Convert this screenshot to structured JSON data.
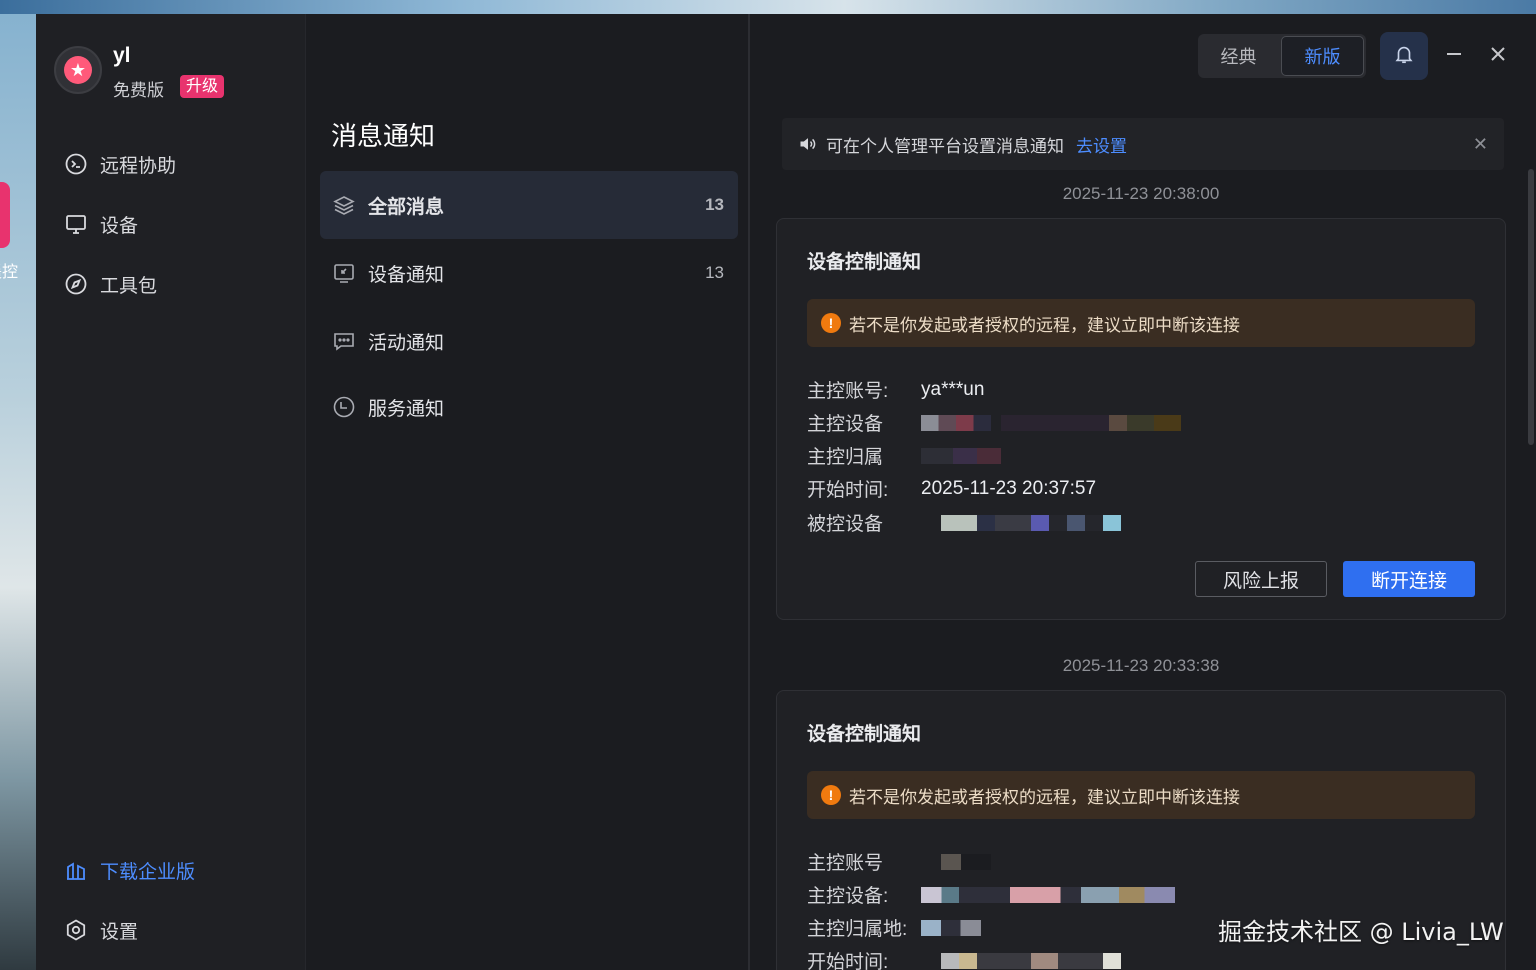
{
  "desktop": {
    "side_text": "遥控"
  },
  "user": {
    "name": "yl",
    "plan": "免费版",
    "upgrade_label": "升级"
  },
  "sidebar": {
    "items": [
      {
        "label": "远程协助",
        "icon": "remote-assist-icon"
      },
      {
        "label": "设备",
        "icon": "device-icon"
      },
      {
        "label": "工具包",
        "icon": "compass-icon"
      }
    ],
    "download_enterprise": "下载企业版",
    "settings": "设置"
  },
  "messages": {
    "title": "消息通知",
    "categories": [
      {
        "label": "全部消息",
        "count": "13",
        "icon": "layers-icon"
      },
      {
        "label": "设备通知",
        "count": "13",
        "icon": "monitor-icon"
      },
      {
        "label": "活动通知",
        "count": "",
        "icon": "chat-icon"
      },
      {
        "label": "服务通知",
        "count": "",
        "icon": "service-icon"
      }
    ]
  },
  "window": {
    "mode_classic": "经典",
    "mode_new": "新版",
    "active_mode": "新版"
  },
  "notice": {
    "text": "可在个人管理平台设置消息通知",
    "link": "去设置"
  },
  "notifications": [
    {
      "timestamp": "2025-11-23 20:38:00",
      "title": "设备控制通知",
      "warning": "若不是你发起或者授权的远程，建议立即中断该连接",
      "fields": [
        {
          "label": "主控账号:",
          "value": "ya***un"
        },
        {
          "label": "主控设备",
          "value": ""
        },
        {
          "label": "主控归属",
          "value": ""
        },
        {
          "label": "开始时间:",
          "value": "2025-11-23 20:37:57"
        },
        {
          "label": "被控设备",
          "value": ""
        }
      ],
      "report_label": "风险上报",
      "disconnect_label": "断开连接"
    },
    {
      "timestamp": "2025-11-23 20:33:38",
      "title": "设备控制通知",
      "warning": "若不是你发起或者授权的远程，建议立即中断该连接",
      "fields": [
        {
          "label": "主控账号",
          "value": ""
        },
        {
          "label": "主控设备:",
          "value": ""
        },
        {
          "label": "主控归属地:",
          "value": ""
        },
        {
          "label": "开始时间:",
          "value": ""
        }
      ]
    }
  ],
  "watermark": "掘金技术社区 @ Livia_LW",
  "colors": {
    "accent": "#2f6ff0",
    "link": "#4d8dff",
    "brand_pink": "#e8336e",
    "warning": "#f07a0f"
  }
}
